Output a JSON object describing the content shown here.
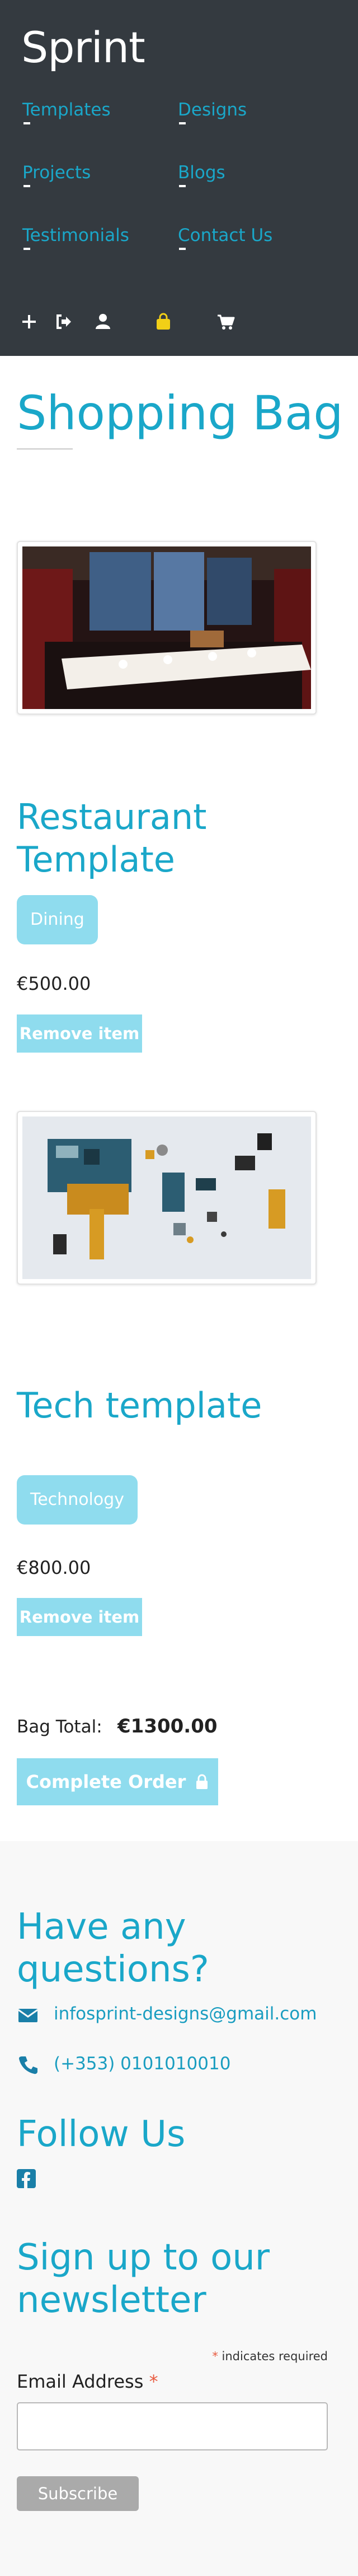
{
  "header": {
    "brand": "Sprint",
    "nav": [
      {
        "label": "Templates"
      },
      {
        "label": "Designs"
      },
      {
        "label": "Projects"
      },
      {
        "label": "Blogs"
      },
      {
        "label": "Testimonials"
      },
      {
        "label": "Contact Us"
      }
    ],
    "icons": [
      "plus-icon",
      "sign-out-icon",
      "user-icon",
      "shopping-bag-icon",
      "cart-icon"
    ]
  },
  "bag": {
    "title": "Shopping Bag",
    "items": [
      {
        "name": "Restaurant Template",
        "category": "Dining",
        "price": "€500.00",
        "remove_label": "Remove item",
        "image": "restaurant-photo"
      },
      {
        "name": "Tech template",
        "category": "Technology",
        "price": "€800.00",
        "remove_label": "Remove item",
        "image": "circuit-board-photo"
      }
    ],
    "total_label": "Bag Total:",
    "total_value": "€1300.00",
    "complete_label": "Complete Order"
  },
  "footer": {
    "questions_heading": "Have any questions?",
    "email": "infosprint-designs@gmail.com",
    "phone": "(+353) 0101010010",
    "follow_heading": "Follow Us",
    "newsletter_heading": "Sign up to our newsletter",
    "required_note": "indicates required",
    "email_label": "Email Address",
    "subscribe_label": "Subscribe"
  },
  "colors": {
    "header_bg": "#343a40",
    "accent": "#1aa7c9",
    "button_bg": "#8fdcee",
    "bag_icon": "#f2cf17"
  }
}
